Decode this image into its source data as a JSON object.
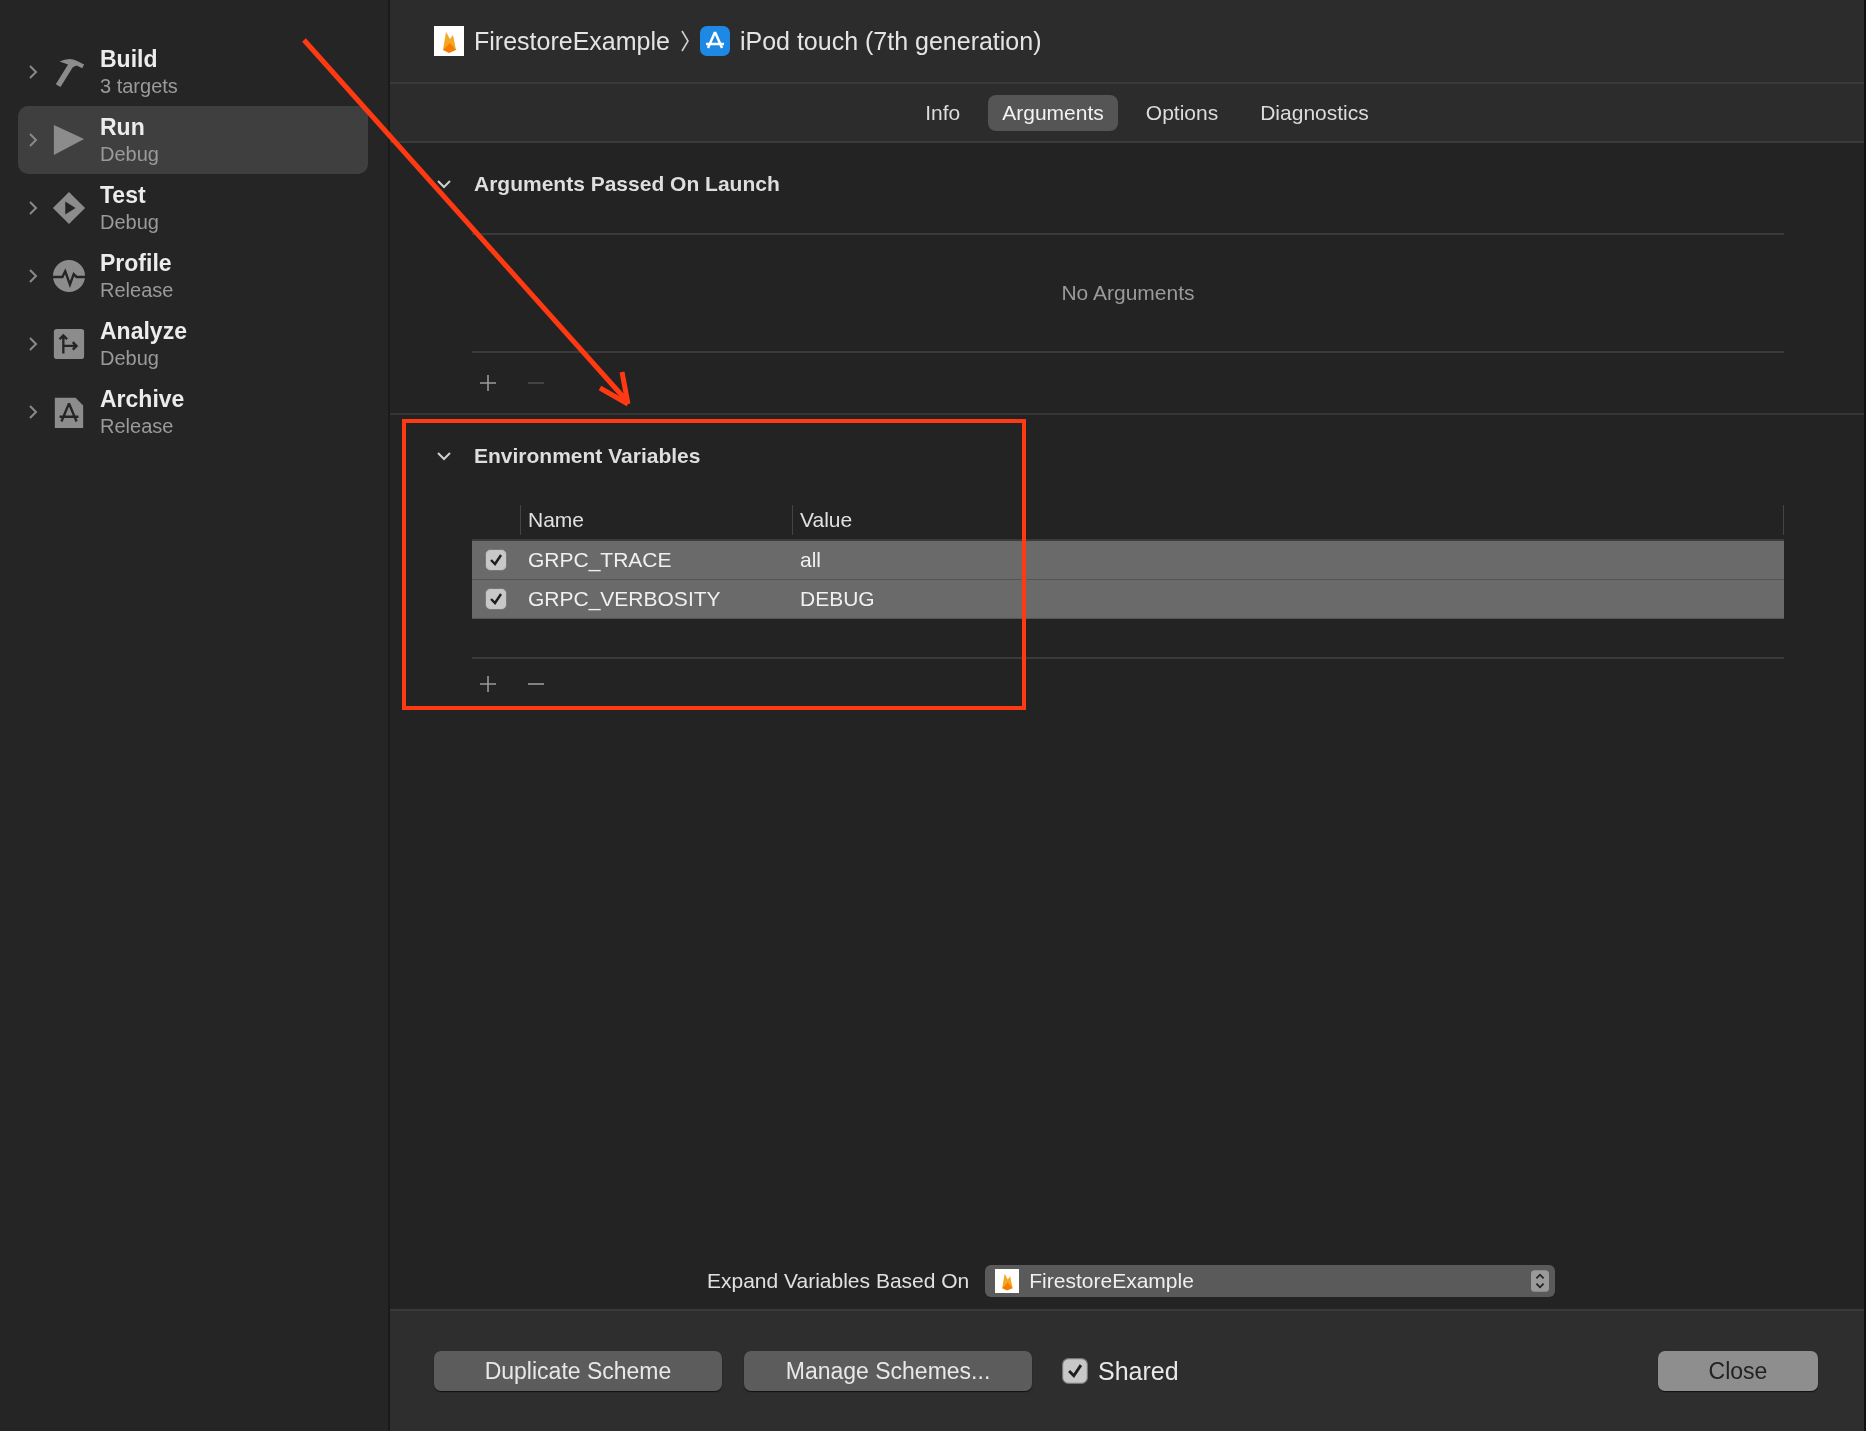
{
  "sidebar": {
    "items": [
      {
        "kind": "build",
        "title": "Build",
        "subtitle": "3 targets",
        "selected": false,
        "expanded": false
      },
      {
        "kind": "run",
        "title": "Run",
        "subtitle": "Debug",
        "selected": true,
        "expanded": false
      },
      {
        "kind": "test",
        "title": "Test",
        "subtitle": "Debug",
        "selected": false,
        "expanded": false
      },
      {
        "kind": "profile",
        "title": "Profile",
        "subtitle": "Release",
        "selected": false,
        "expanded": false
      },
      {
        "kind": "analyze",
        "title": "Analyze",
        "subtitle": "Debug",
        "selected": false,
        "expanded": false
      },
      {
        "kind": "archive",
        "title": "Archive",
        "subtitle": "Release",
        "selected": false,
        "expanded": false
      }
    ]
  },
  "header": {
    "project": "FirestoreExample",
    "device": "iPod touch (7th generation)"
  },
  "tabs": [
    {
      "label": "Info",
      "selected": false
    },
    {
      "label": "Arguments",
      "selected": true
    },
    {
      "label": "Options",
      "selected": false
    },
    {
      "label": "Diagnostics",
      "selected": false
    }
  ],
  "arguments_section": {
    "title": "Arguments Passed On Launch",
    "expanded": true,
    "empty_text": "No Arguments",
    "remove_enabled": false
  },
  "environment_section": {
    "title": "Environment Variables",
    "expanded": true,
    "columns": [
      "Name",
      "Value"
    ],
    "remove_enabled": true,
    "rows": [
      {
        "name": "GRPC_TRACE",
        "value": "all",
        "checked": true,
        "selected": true
      },
      {
        "name": "GRPC_VERBOSITY",
        "value": "DEBUG",
        "checked": true,
        "selected": true
      }
    ]
  },
  "expand_variables": {
    "label": "Expand Variables Based On",
    "value": "FirestoreExample"
  },
  "footer": {
    "buttons": [
      "Duplicate Scheme",
      "Manage Schemes..."
    ],
    "shared": {
      "label": "Shared",
      "checked": true
    },
    "close": "Close"
  }
}
